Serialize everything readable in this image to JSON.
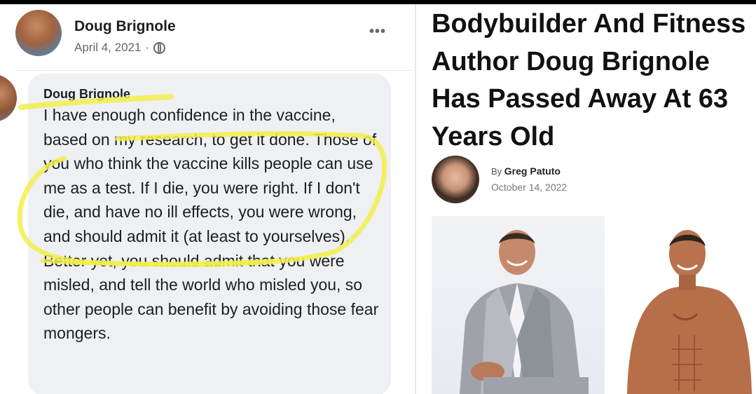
{
  "facebook_post": {
    "author": "Doug Brignole",
    "date": "April 4, 2021",
    "separator": "·",
    "visibility_icon": "globe-icon",
    "more_icon": "more-options-icon",
    "comment": {
      "author": "Doug Brignole",
      "text": "I have enough confidence in the vaccine, based on my research, to get it done. Those of you who think the vaccine kills people can use me as a test. If I die, you were right. If I don't die, and have no ill effects, you were wrong, and should admit it (at least to yourselves). Better yet, you should admit that you were misled, and tell the world who misled you, so other people can benefit by avoiding those fear mongers.",
      "highlight_color": "#f2ee4a"
    }
  },
  "article": {
    "headline": "Bodybuilder And Fitness Author Doug Brignole Has Passed Away At 63 Years Old",
    "byline_prefix": "By",
    "byline_author": "Greg Patuto",
    "date": "October 14, 2022"
  }
}
